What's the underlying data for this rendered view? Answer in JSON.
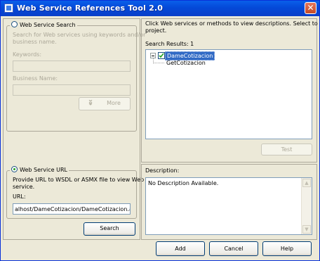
{
  "window": {
    "title": "Web Service References Tool 2.0",
    "close_symbol": "✕",
    "title_icon": "app-icon"
  },
  "search_section": {
    "radio_label": "Web Service Search",
    "selected": false,
    "description": [
      "Search for Web services using keywords and/or",
      "business name."
    ],
    "keywords_label": "Keywords:",
    "keywords_value": "",
    "business_label": "Business Name:",
    "business_value": "",
    "more_label": "More",
    "more_icon": "chevron-double-icon"
  },
  "url_section": {
    "radio_label": "Web Service URL",
    "selected": true,
    "description": [
      "Provide URL to WSDL or ASMX file to view Web",
      "service."
    ],
    "url_label": "URL:",
    "url_value": "alhost/DameCotizacion/DameCotizacion.asmx",
    "search_label": "Search"
  },
  "results": {
    "instructions": [
      "Click Web services or methods to view descriptions. Select to add to",
      "project."
    ],
    "label": "Search Results: 1",
    "tree": {
      "root": {
        "label": "DameCotizacion",
        "checked": true,
        "expanded": true,
        "selected": true
      },
      "children": [
        "GetCotizacion"
      ]
    },
    "test_label": "Test"
  },
  "description": {
    "label": "Description:",
    "text": "No Description Available."
  },
  "footer": {
    "add_label": "Add",
    "cancel_label": "Cancel",
    "help_label": "Help"
  }
}
